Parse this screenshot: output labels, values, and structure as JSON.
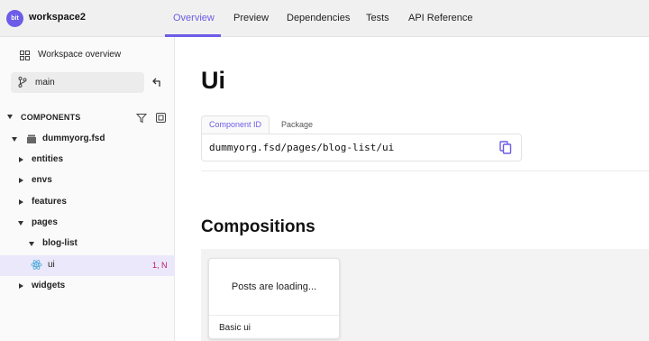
{
  "header": {
    "logo_text": "bit",
    "workspace_name": "workspace2",
    "tabs": [
      {
        "label": "Overview",
        "active": true
      },
      {
        "label": "Preview",
        "active": false
      },
      {
        "label": "Dependencies",
        "active": false
      },
      {
        "label": "Tests",
        "active": false
      },
      {
        "label": "API Reference",
        "active": false
      }
    ]
  },
  "sidebar": {
    "overview_label": "Workspace overview",
    "branch": "main",
    "components_heading": "COMPONENTS",
    "scope": "dummyorg.fsd",
    "tree": [
      {
        "label": "entities",
        "expanded": false
      },
      {
        "label": "envs",
        "expanded": false
      },
      {
        "label": "features",
        "expanded": false
      },
      {
        "label": "pages",
        "expanded": true
      },
      {
        "label": "blog-list",
        "expanded": true
      },
      {
        "label": "ui",
        "status": "1, N",
        "selected": true
      },
      {
        "label": "widgets",
        "expanded": false
      }
    ]
  },
  "main": {
    "title": "Ui",
    "id_tabs": [
      "Component ID",
      "Package"
    ],
    "component_id": "dummyorg.fsd/pages/blog-list/ui",
    "compositions_title": "Compositions",
    "compositions": [
      {
        "preview_text": "Posts are loading...",
        "name": "Basic ui"
      }
    ]
  },
  "colors": {
    "accent": "#6c5ce7",
    "status": "#c2185b",
    "selected_bg": "#ece8fb"
  }
}
